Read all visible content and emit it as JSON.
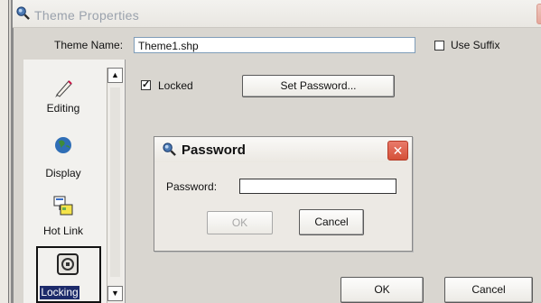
{
  "window": {
    "title": "Theme Properties",
    "theme_name_label": "Theme Name:",
    "theme_name_value": "Theme1.shp",
    "use_suffix_label": "Use Suffix",
    "use_suffix_checked": false,
    "close_glyph": "✕"
  },
  "sidebar": {
    "items": [
      {
        "label": "Editing",
        "icon": "pencil-icon"
      },
      {
        "label": "Display",
        "icon": "globe-icon"
      },
      {
        "label": "Hot Link",
        "icon": "hotlink-icon"
      },
      {
        "label": "Locking",
        "icon": "lock-icon",
        "selected": true
      }
    ]
  },
  "locking": {
    "locked_label": "Locked",
    "locked_checked": true,
    "set_password_label": "Set Password..."
  },
  "password_dialog": {
    "title": "Password",
    "field_label": "Password:",
    "field_value": "",
    "ok_label": "OK",
    "cancel_label": "Cancel",
    "close_glyph": "✕"
  },
  "footer": {
    "ok_label": "OK",
    "cancel_label": "Cancel"
  },
  "colors": {
    "dialog_background": "#ece9e4",
    "close_red": "#d45038",
    "field_border": "#7f9db9"
  }
}
